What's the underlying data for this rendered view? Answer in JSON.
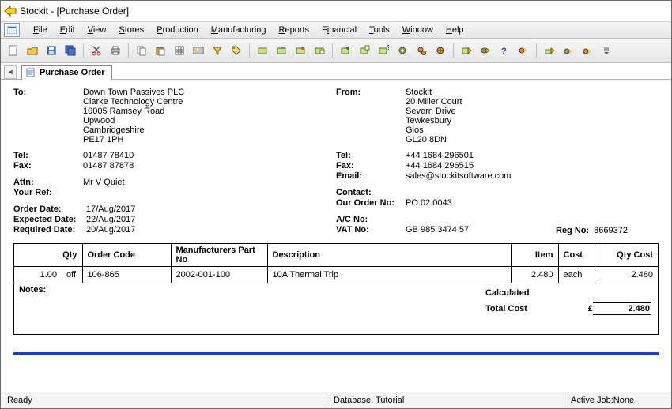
{
  "window": {
    "title": "Stockit - [Purchase Order]"
  },
  "menu": {
    "file": "File",
    "edit": "Edit",
    "view": "View",
    "stores": "Stores",
    "production": "Production",
    "manufacturing": "Manufacturing",
    "reports": "Reports",
    "financial": "Financial",
    "tools": "Tools",
    "window": "Window",
    "help": "Help"
  },
  "tab": {
    "label": "Purchase Order"
  },
  "labels": {
    "to": "To:",
    "from": "From:",
    "tel": "Tel:",
    "fax": "Fax:",
    "email": "Email:",
    "attn": "Attn:",
    "yourref": "Your Ref:",
    "contact": "Contact:",
    "ourorderno": "Our Order No:",
    "orderdate": "Order Date:",
    "expecteddate": "Expected Date:",
    "requireddate": "Required Date:",
    "acno": "A/C No:",
    "vatno": "VAT No:",
    "regno": "Reg No:",
    "notes": "Notes:",
    "calculated": "Calculated",
    "totalcost": "Total Cost",
    "currency": "£"
  },
  "to": {
    "lines": [
      "Down Town Passives PLC",
      "Clarke Technology Centre",
      "10005 Ramsey Road",
      "Upwood",
      "Cambridgeshire",
      "PE17 1PH"
    ],
    "tel": "01487 78410",
    "fax": "01487 87878",
    "attn": "Mr V Quiet",
    "yourref": ""
  },
  "from": {
    "lines": [
      "Stockit",
      "20 Miller Court",
      "Severn Drive",
      "Tewkesbury",
      "Glos",
      "GL20 8DN"
    ],
    "tel": "+44 1684 296501",
    "fax": "+44 1684 296515",
    "email": "sales@stockitsoftware.com",
    "contact": "",
    "ourorderno": "PO.02.0043",
    "acno": "",
    "vatno": "GB 985 3474 57",
    "regno": "8669372"
  },
  "dates": {
    "order": "17/Aug/2017",
    "expected": "22/Aug/2017",
    "required": "20/Aug/2017"
  },
  "table": {
    "headers": {
      "qty": "Qty",
      "ordercode": "Order Code",
      "mpn": "Manufacturers Part No",
      "desc": "Description",
      "item": "Item",
      "cost": "Cost",
      "qtycost": "Qty Cost"
    },
    "rows": [
      {
        "qty": "1.00",
        "unit": "off",
        "ordercode": "106-865",
        "mpn": "2002-001-100",
        "desc": "10A Thermal Trip",
        "item": "2.480",
        "cost": "each",
        "qtycost": "2.480"
      }
    ]
  },
  "totals": {
    "total": "2.480"
  },
  "status": {
    "ready": "Ready",
    "db": "Database: Tutorial",
    "activejob": "Active Job:None"
  }
}
